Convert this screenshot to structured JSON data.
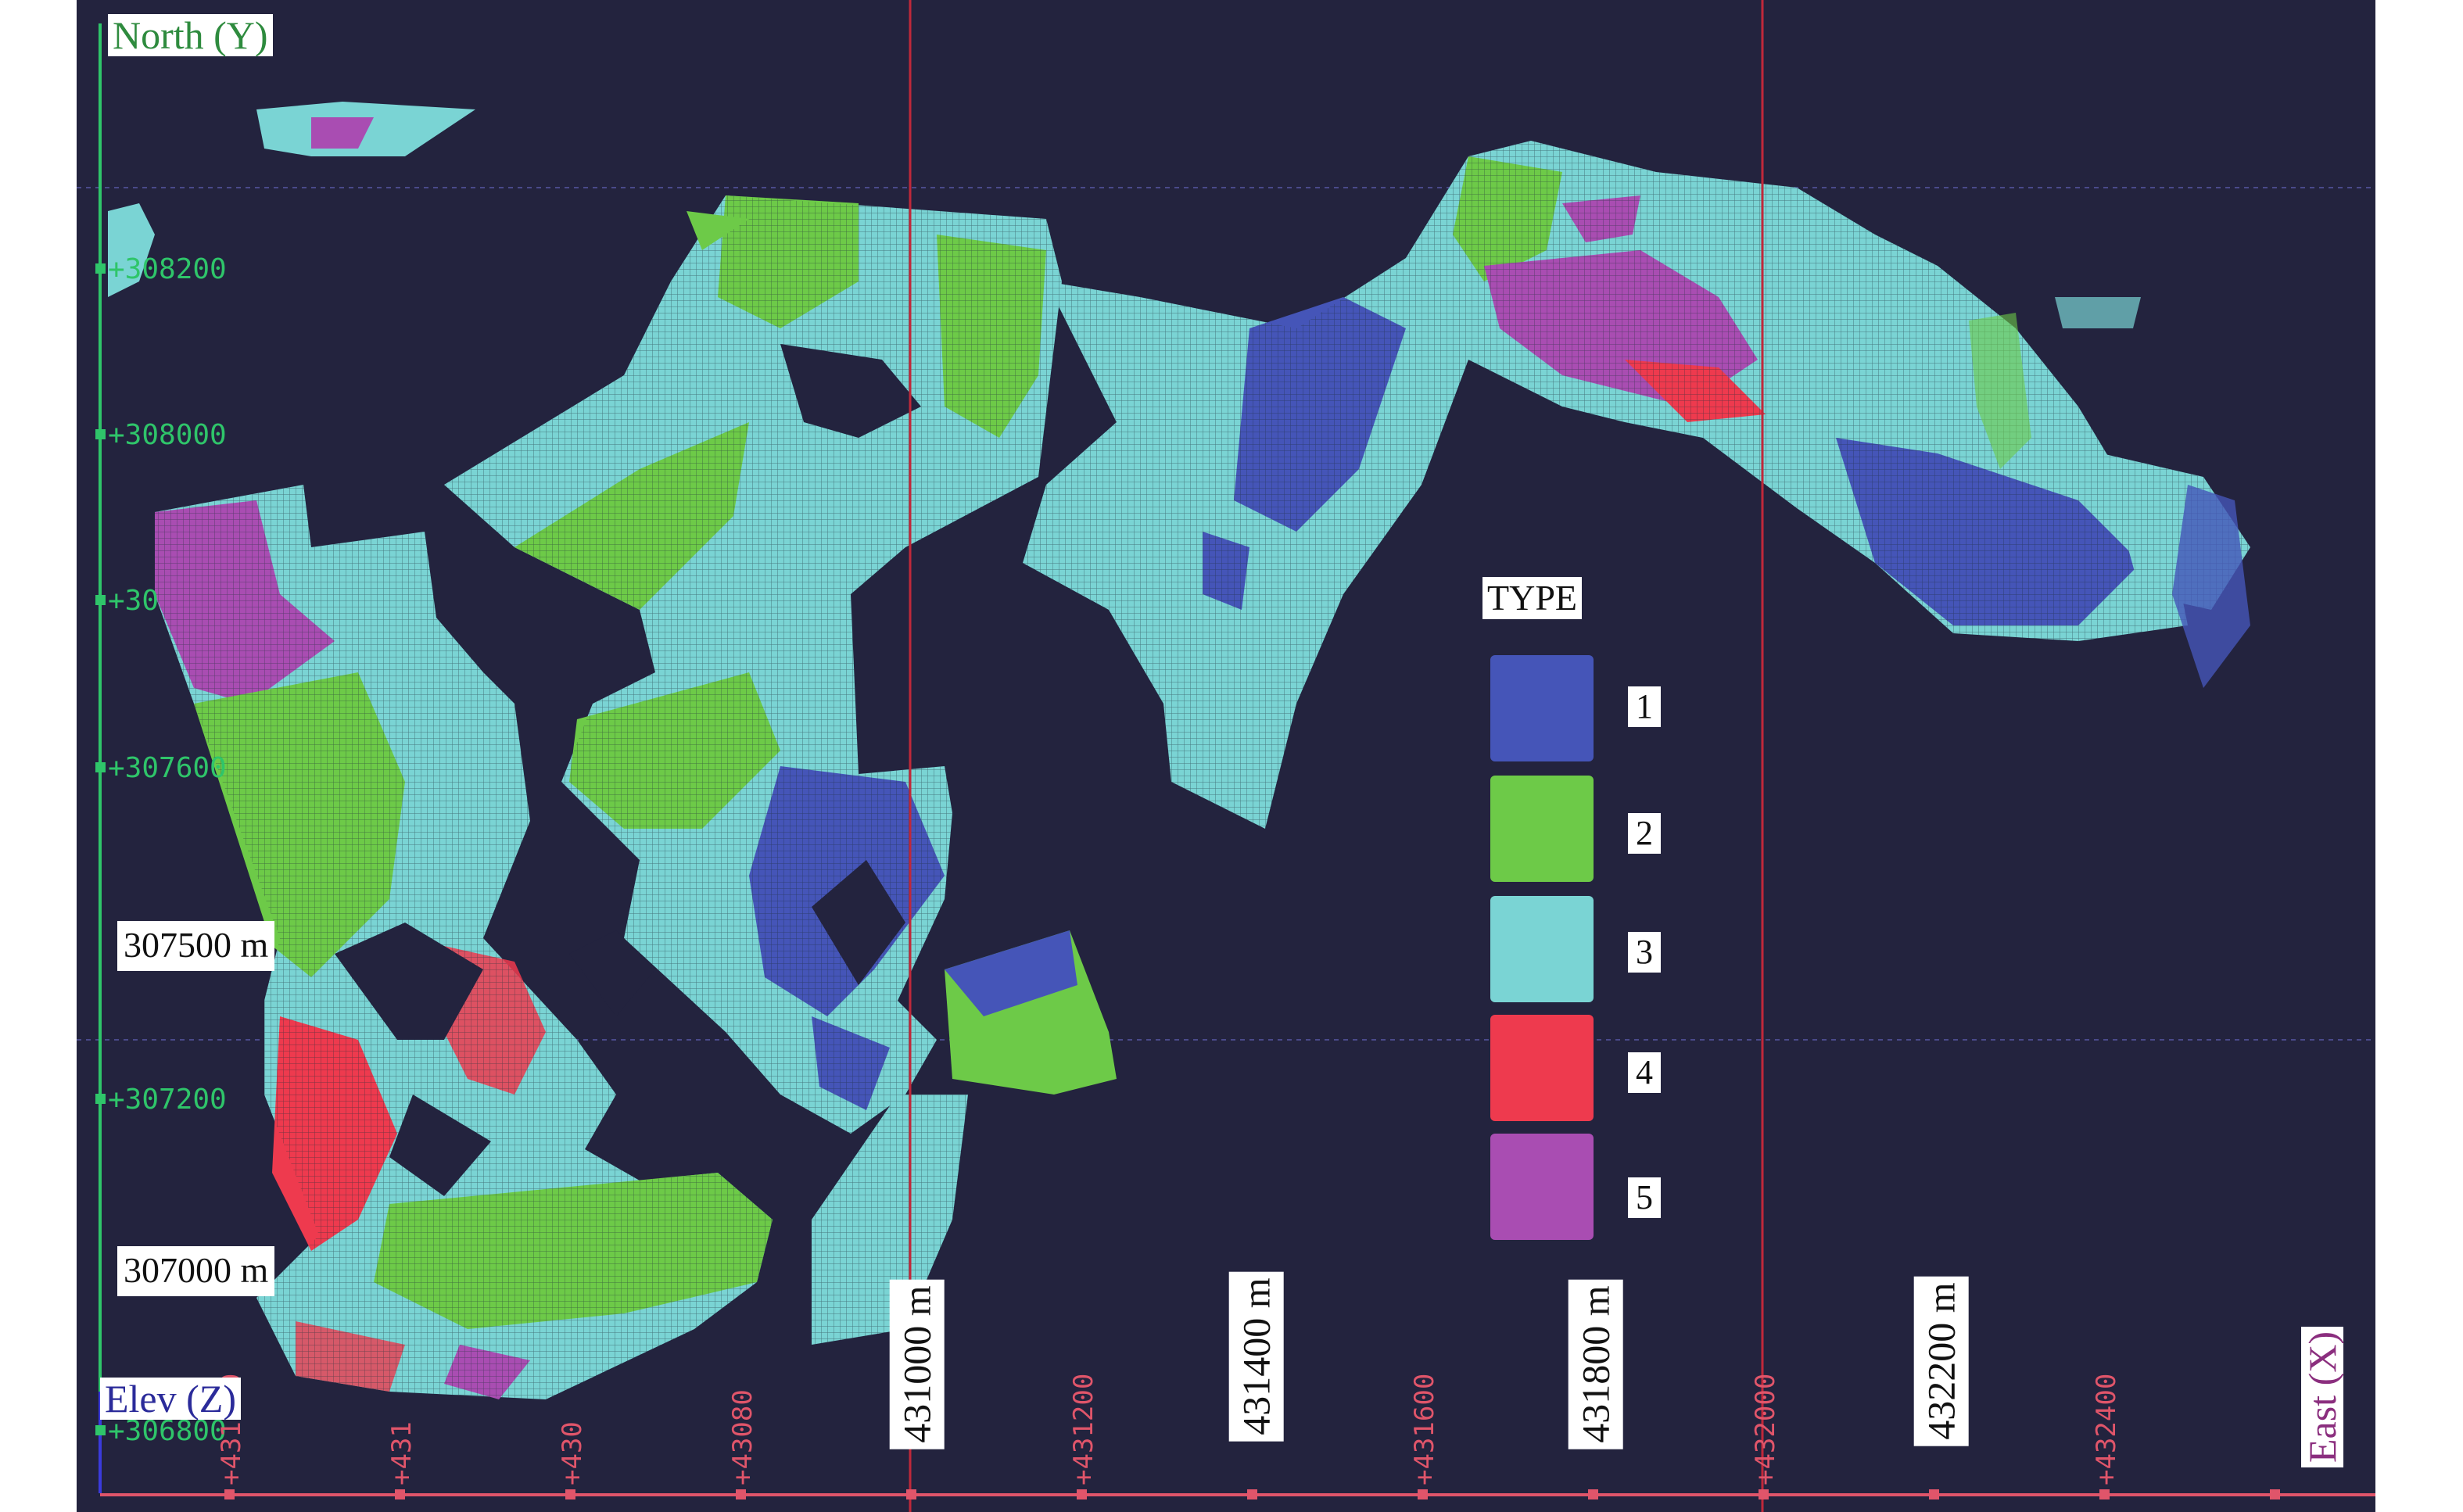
{
  "axes": {
    "north": "North (Y)",
    "elev": "Elev (Z)",
    "east": "East (X)"
  },
  "y_ticks": [
    "+308200",
    "+308000",
    "+30",
    "+307600",
    "+307200",
    "+306800"
  ],
  "x_ticks": [
    "+431000",
    "+431",
    "+430",
    "+43080",
    "+431200",
    "+431600",
    "+432000",
    "+432400"
  ],
  "y_coord_labels": [
    "307500 m",
    "307000 m"
  ],
  "x_coord_labels": [
    "431000 m",
    "431400 m",
    "431800 m",
    "432200 m"
  ],
  "legend": {
    "title": "TYPE",
    "items": [
      {
        "label": "1",
        "color": "#4555b8"
      },
      {
        "label": "2",
        "color": "#6dca48"
      },
      {
        "label": "3",
        "color": "#7ad4d4"
      },
      {
        "label": "4",
        "color": "#ee3a4e"
      },
      {
        "label": "5",
        "color": "#a94db2"
      }
    ]
  },
  "colors": {
    "background": "#23233e",
    "y_axis": "#2fc56a",
    "x_axis": "#e0556a",
    "section_line": "#c0283a",
    "grid": "#4a4a8a"
  }
}
